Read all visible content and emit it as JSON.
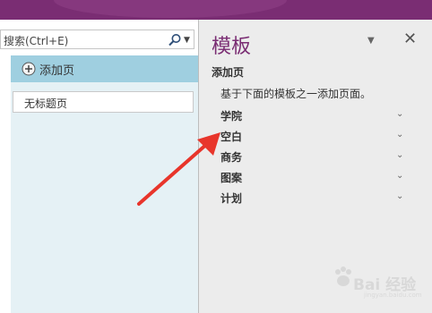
{
  "search": {
    "placeholder": "搜索(Ctrl+E)"
  },
  "pages": {
    "add_page": "添加页",
    "items": [
      "无标题页"
    ]
  },
  "templates_pane": {
    "title": "模板",
    "section": "添加页",
    "description": "基于下面的模板之一添加页面。",
    "categories": [
      "学院",
      "空白",
      "商务",
      "图案",
      "计划"
    ]
  },
  "watermark": {
    "text": "Bai 经验",
    "sub": "jingyan.baidu.com"
  },
  "colors": {
    "accent": "#7a2d73",
    "add_page_bg": "#9fcfe0",
    "page_panel_bg": "#e5f1f5",
    "pane_bg": "#ececec",
    "arrow": "#e8352b"
  }
}
